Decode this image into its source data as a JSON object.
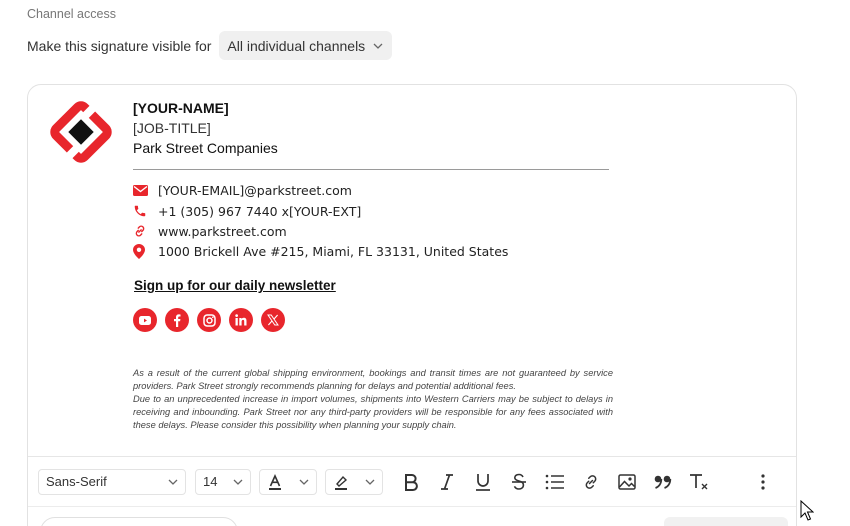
{
  "channel_access": {
    "section_label": "Channel access",
    "visible_for_label": "Make this signature visible for",
    "visible_for_value": "All individual channels"
  },
  "signature": {
    "name": "[YOUR-NAME]",
    "job_title": "[JOB-TITLE]",
    "company": "Park Street Companies",
    "contacts": [
      {
        "icon": "email-icon",
        "text": "[YOUR-EMAIL]@parkstreet.com"
      },
      {
        "icon": "phone-icon",
        "text": "+1 (305) 967 7440 x[YOUR-EXT]"
      },
      {
        "icon": "link-icon",
        "text": "www.parkstreet.com"
      },
      {
        "icon": "location-pin-icon",
        "text": "1000 Brickell Ave #215, Miami, FL 33131, United States"
      }
    ],
    "newsletter_link": "Sign up for our daily newsletter",
    "socials": [
      "youtube",
      "facebook",
      "instagram",
      "linkedin",
      "x"
    ],
    "disclaimer": [
      "As a result of the current global shipping environment, bookings and transit times are not guaranteed by service providers. Park Street strongly recommends planning for delays and potential additional fees.",
      "Due to an unprecedented increase in import volumes, shipments into Western Carriers may be subject to delays in receiving and inbounding. Park Street nor any third-party providers will be responsible for any fees associated with these delays. Please consider this possibility when planning your supply chain."
    ],
    "accent_color": "#e8262c"
  },
  "toolbar": {
    "font_family": "Sans-Serif",
    "font_size": "14"
  }
}
